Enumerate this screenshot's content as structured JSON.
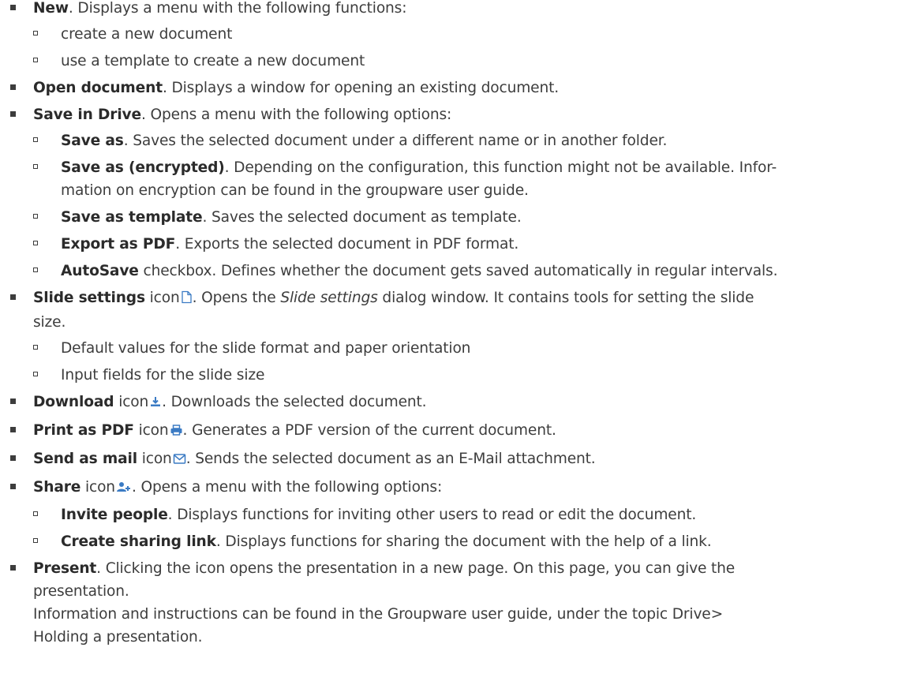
{
  "items": [
    {
      "label": "New",
      "text": ". Displays a menu with the following functions:",
      "sub": [
        {
          "text": "create a new document"
        },
        {
          "text": "use a template to create a new document"
        }
      ]
    },
    {
      "label": "Open document",
      "text": ". Displays a window for opening an existing document."
    },
    {
      "label": "Save in Drive",
      "text": ". Opens a menu with the following options:",
      "sub": [
        {
          "label": "Save as",
          "text": ". Saves the selected document under a different name or in another folder."
        },
        {
          "label": "Save as (encrypted)",
          "text": ". Depending on the configuration, this function might not be available. Infor-",
          "text2": "mation on encryption can be found in the groupware user guide."
        },
        {
          "label": "Save as template",
          "text": ". Saves the selected document as template."
        },
        {
          "label": "Export as PDF",
          "text": ". Exports the selected document in PDF format."
        },
        {
          "label": "AutoSave",
          "text": " checkbox. Defines whether the document gets saved automatically in regular intervals."
        }
      ]
    },
    {
      "label": "Slide settings",
      "icon_word": " icon",
      "icon": "slide-settings-icon",
      "text_a": ". Opens the ",
      "italic": "Slide settings",
      "text_b": " dialog window. It contains tools for setting the slide",
      "text2": "size.",
      "sub": [
        {
          "text": "Default values for the slide format and paper orientation"
        },
        {
          "text": "Input fields for the slide size"
        }
      ]
    },
    {
      "label": "Download",
      "icon_word": " icon",
      "icon": "download-icon",
      "text": ". Downloads the selected document."
    },
    {
      "label": "Print as PDF",
      "icon_word": " icon",
      "icon": "print-icon",
      "text": ". Generates a PDF version of the current document."
    },
    {
      "label": "Send as mail",
      "icon_word": " icon",
      "icon": "mail-icon",
      "text": ". Sends the selected document as an E-Mail attachment."
    },
    {
      "label": "Share",
      "icon_word": " icon",
      "icon": "share-user-icon",
      "text": ". Opens a menu with the following options:",
      "sub": [
        {
          "label": "Invite people",
          "text": ". Displays functions for inviting other users to read or edit the document."
        },
        {
          "label": "Create sharing link",
          "text": ". Displays functions for sharing the document with the help of a link."
        }
      ]
    },
    {
      "label": "Present",
      "text": ". Clicking the icon opens the presentation in a new page. On this page, you can give the",
      "text2": "presentation.",
      "text3": "Information and instructions can be found in the Groupware user guide, under the topic Drive>",
      "text4": "Holding a presentation."
    }
  ],
  "colors": {
    "text": "#3d3d3d",
    "icon_blue": "#3b7bc4"
  }
}
